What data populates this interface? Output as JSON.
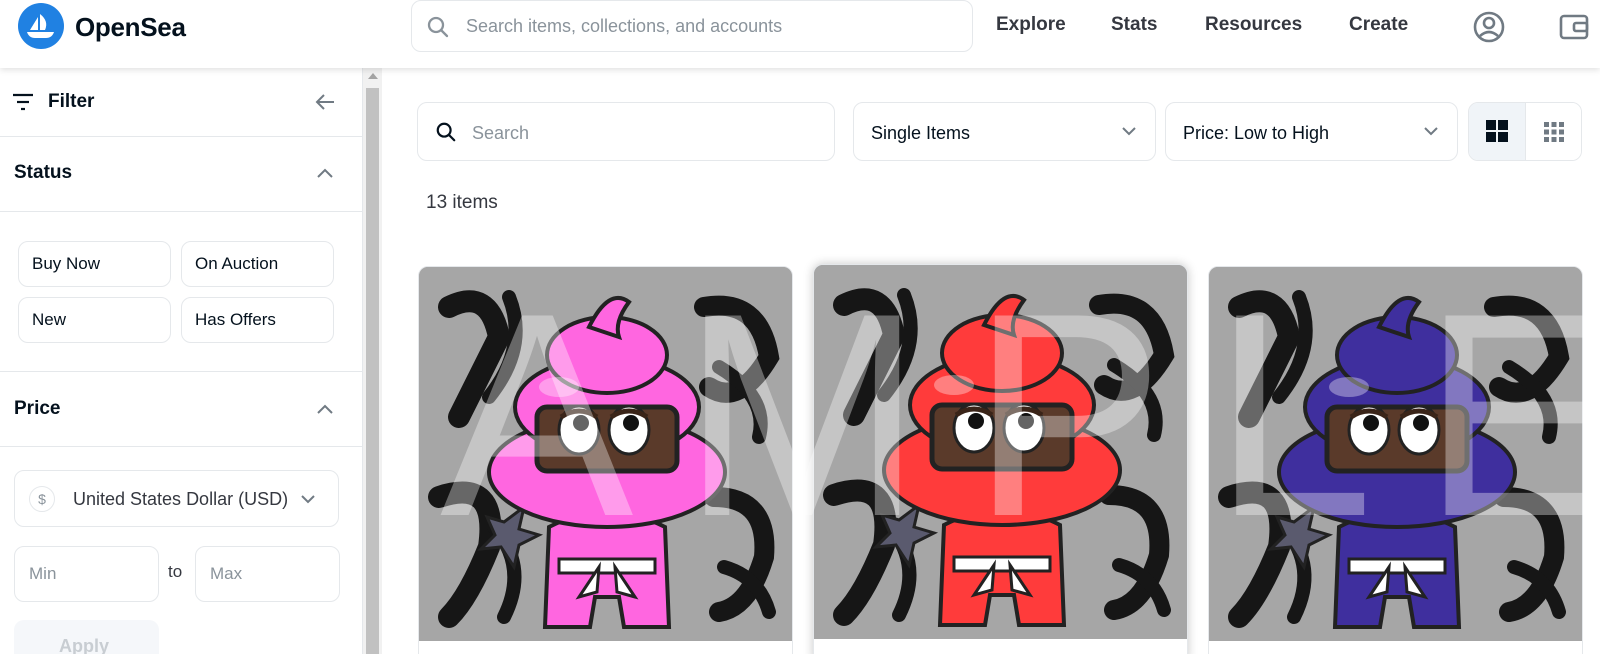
{
  "header": {
    "brand": "OpenSea",
    "search_placeholder": "Search items, collections, and accounts",
    "nav": [
      "Explore",
      "Stats",
      "Resources",
      "Create"
    ]
  },
  "sidebar": {
    "filter_title": "Filter",
    "status": {
      "title": "Status",
      "options": [
        "Buy Now",
        "On Auction",
        "New",
        "Has Offers"
      ]
    },
    "price": {
      "title": "Price",
      "currency_symbol": "$",
      "currency": "United States Dollar (USD)",
      "min_placeholder": "Min",
      "to_label": "to",
      "max_placeholder": "Max",
      "apply_label": "Apply"
    }
  },
  "main": {
    "search_placeholder": "Search",
    "type_filter": "Single Items",
    "sort": "Price: Low to High",
    "item_count": "13 items",
    "watermark": "AMPLE",
    "cards": [
      {
        "color": "#ff66e0",
        "shade": "#e04ec4"
      },
      {
        "color": "#ff3b3b",
        "shade": "#d92a2a"
      },
      {
        "color": "#3f2f9e",
        "shade": "#2d2180"
      }
    ]
  }
}
